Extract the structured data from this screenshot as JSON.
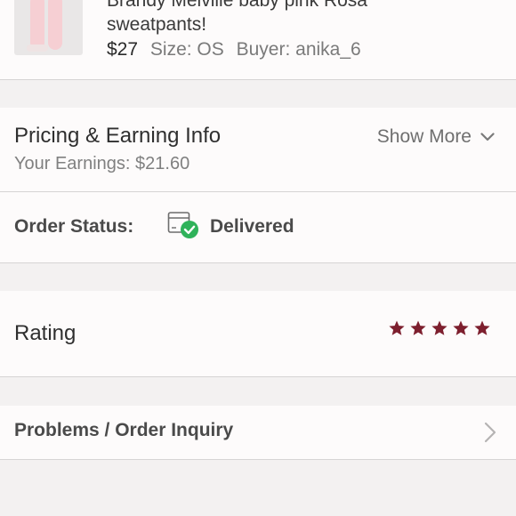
{
  "item": {
    "title_line1": "Brandy Melville baby pink Rosa",
    "title_line2": "sweatpants!",
    "price": "$27",
    "size": "Size: OS",
    "buyer": "Buyer: anika_6"
  },
  "pricing": {
    "title": "Pricing & Earning Info",
    "earnings": "Your Earnings: $21.60",
    "show_more": "Show More"
  },
  "status": {
    "label": "Order Status:",
    "value": "Delivered"
  },
  "rating": {
    "label": "Rating",
    "stars": 5,
    "max_stars": 5,
    "star_color": "#7d1f2e"
  },
  "problems": {
    "label": "Problems / Order Inquiry"
  },
  "colors": {
    "delivered_check": "#2fb25a",
    "background": "#f3f1f1",
    "section_bg": "#fdfbfb"
  }
}
